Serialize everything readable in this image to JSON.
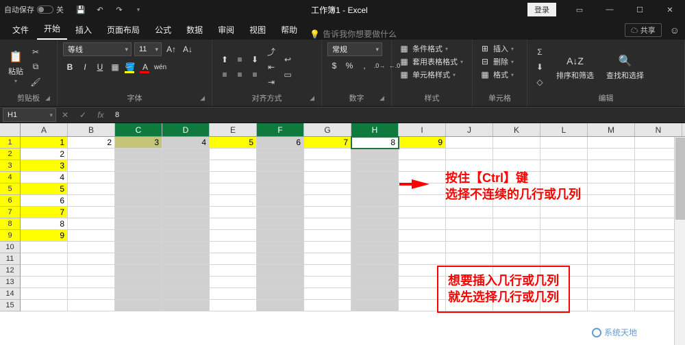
{
  "title_bar": {
    "autosave_label": "自动保存",
    "autosave_state": "关",
    "title": "工作簿1 - Excel",
    "login": "登录"
  },
  "tabs": {
    "file": "文件",
    "home": "开始",
    "insert": "插入",
    "page_layout": "页面布局",
    "formulas": "公式",
    "data": "数据",
    "review": "审阅",
    "view": "视图",
    "help": "帮助",
    "tell_me": "告诉我你想要做什么",
    "share": "共享"
  },
  "ribbon": {
    "clipboard": {
      "label": "剪贴板",
      "paste": "粘贴"
    },
    "font": {
      "label": "字体",
      "name": "等线",
      "size": "11",
      "bold": "B",
      "italic": "I",
      "underline": "U"
    },
    "align": {
      "label": "对齐方式"
    },
    "number": {
      "label": "数字",
      "format": "常规"
    },
    "styles": {
      "label": "样式",
      "cond": "条件格式",
      "table": "套用表格格式",
      "cell": "单元格样式"
    },
    "cells": {
      "label": "单元格",
      "insert": "插入",
      "delete": "删除",
      "format": "格式"
    },
    "editing": {
      "label": "编辑",
      "sort": "排序和筛选",
      "find": "查找和选择"
    }
  },
  "formula_bar": {
    "name_box": "H1",
    "value": "8"
  },
  "columns": [
    "A",
    "B",
    "C",
    "D",
    "E",
    "F",
    "G",
    "H",
    "I",
    "J",
    "K",
    "L",
    "M",
    "N"
  ],
  "selected_cols": [
    "C",
    "D",
    "F",
    "H"
  ],
  "active_cell": {
    "row": 1,
    "col": "H"
  },
  "data_row1": {
    "A": "1",
    "B": "2",
    "C": "3",
    "D": "4",
    "E": "5",
    "F": "6",
    "G": "7",
    "H": "8",
    "I": "9"
  },
  "row_values": {
    "1": "1",
    "2": "2",
    "3": "3",
    "4": "4",
    "5": "5",
    "6": "6",
    "7": "7",
    "8": "8",
    "9": "9"
  },
  "yellow_rows": [
    1,
    3,
    5,
    7,
    9
  ],
  "visible_rows": 15,
  "annotations": {
    "text1_line1": "按住【Ctrl】键",
    "text1_line2": "选择不连续的几行或几列",
    "box_line1": "想要插入几行或几列",
    "box_line2": "就先选择几行或几列"
  },
  "watermark": "系统天地"
}
